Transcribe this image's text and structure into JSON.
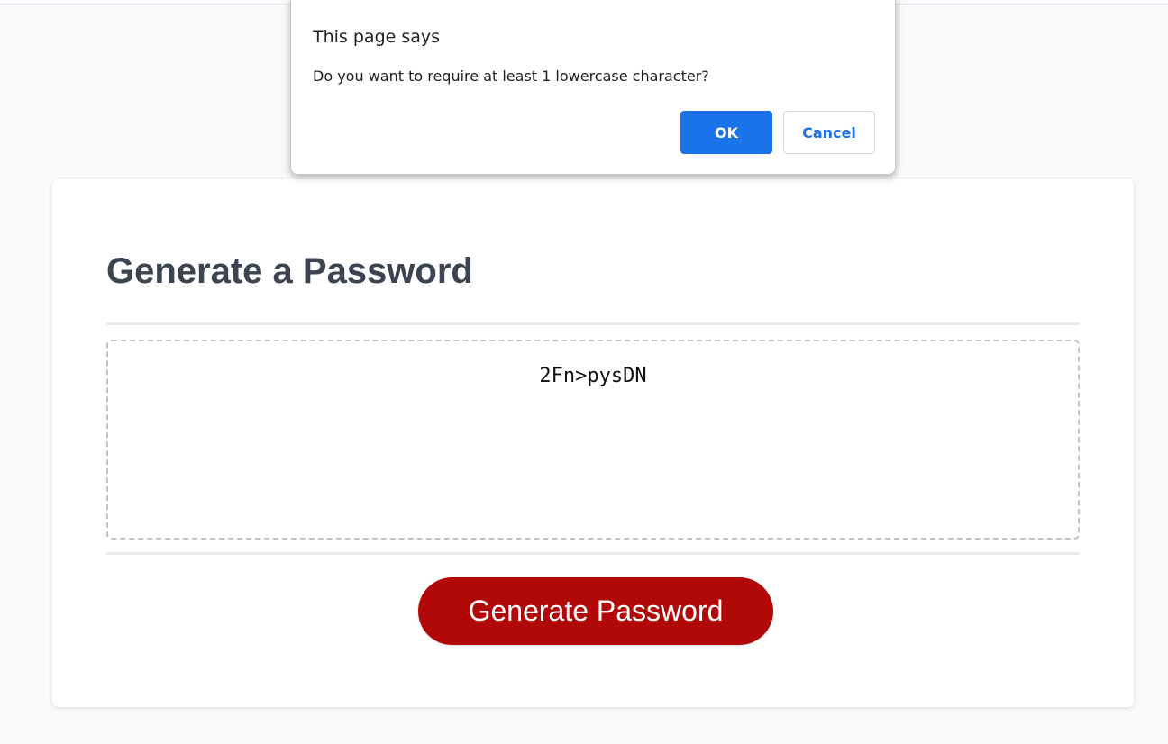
{
  "page": {
    "title": "Generate a Password",
    "password": "2Fn>pysDN",
    "generate_button_label": "Generate Password"
  },
  "dialog": {
    "title": "This page says",
    "message": "Do you want to require at least 1 lowercase character?",
    "ok_label": "OK",
    "cancel_label": "Cancel"
  },
  "colors": {
    "background": "#f8f9fa",
    "card": "#ffffff",
    "title_text": "#3b4450",
    "generate_button": "#b10808",
    "dialog_accent": "#1a73e8"
  }
}
